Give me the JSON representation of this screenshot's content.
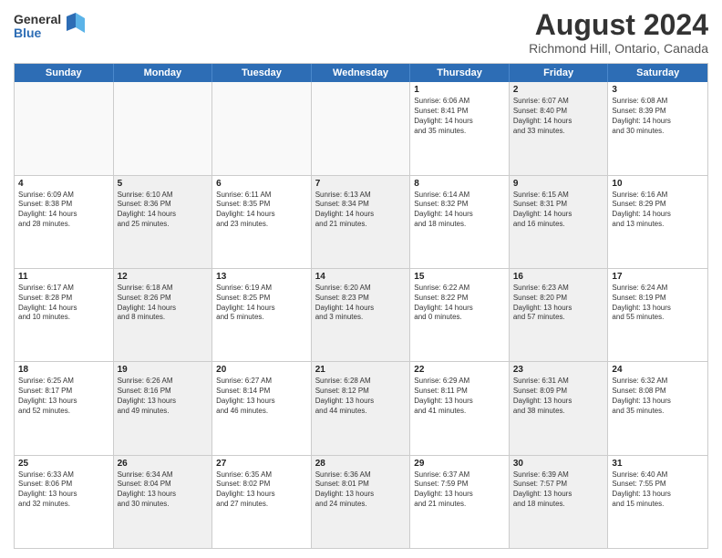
{
  "header": {
    "logo_line1": "General",
    "logo_line2": "Blue",
    "month_title": "August 2024",
    "location": "Richmond Hill, Ontario, Canada"
  },
  "days_of_week": [
    "Sunday",
    "Monday",
    "Tuesday",
    "Wednesday",
    "Thursday",
    "Friday",
    "Saturday"
  ],
  "weeks": [
    [
      {
        "day": "",
        "empty": true,
        "shaded": false
      },
      {
        "day": "",
        "empty": true,
        "shaded": false
      },
      {
        "day": "",
        "empty": true,
        "shaded": false
      },
      {
        "day": "",
        "empty": true,
        "shaded": false
      },
      {
        "day": "1",
        "empty": false,
        "shaded": false,
        "line1": "Sunrise: 6:06 AM",
        "line2": "Sunset: 8:41 PM",
        "line3": "Daylight: 14 hours",
        "line4": "and 35 minutes."
      },
      {
        "day": "2",
        "empty": false,
        "shaded": true,
        "line1": "Sunrise: 6:07 AM",
        "line2": "Sunset: 8:40 PM",
        "line3": "Daylight: 14 hours",
        "line4": "and 33 minutes."
      },
      {
        "day": "3",
        "empty": false,
        "shaded": false,
        "line1": "Sunrise: 6:08 AM",
        "line2": "Sunset: 8:39 PM",
        "line3": "Daylight: 14 hours",
        "line4": "and 30 minutes."
      }
    ],
    [
      {
        "day": "4",
        "empty": false,
        "shaded": false,
        "line1": "Sunrise: 6:09 AM",
        "line2": "Sunset: 8:38 PM",
        "line3": "Daylight: 14 hours",
        "line4": "and 28 minutes."
      },
      {
        "day": "5",
        "empty": false,
        "shaded": true,
        "line1": "Sunrise: 6:10 AM",
        "line2": "Sunset: 8:36 PM",
        "line3": "Daylight: 14 hours",
        "line4": "and 25 minutes."
      },
      {
        "day": "6",
        "empty": false,
        "shaded": false,
        "line1": "Sunrise: 6:11 AM",
        "line2": "Sunset: 8:35 PM",
        "line3": "Daylight: 14 hours",
        "line4": "and 23 minutes."
      },
      {
        "day": "7",
        "empty": false,
        "shaded": true,
        "line1": "Sunrise: 6:13 AM",
        "line2": "Sunset: 8:34 PM",
        "line3": "Daylight: 14 hours",
        "line4": "and 21 minutes."
      },
      {
        "day": "8",
        "empty": false,
        "shaded": false,
        "line1": "Sunrise: 6:14 AM",
        "line2": "Sunset: 8:32 PM",
        "line3": "Daylight: 14 hours",
        "line4": "and 18 minutes."
      },
      {
        "day": "9",
        "empty": false,
        "shaded": true,
        "line1": "Sunrise: 6:15 AM",
        "line2": "Sunset: 8:31 PM",
        "line3": "Daylight: 14 hours",
        "line4": "and 16 minutes."
      },
      {
        "day": "10",
        "empty": false,
        "shaded": false,
        "line1": "Sunrise: 6:16 AM",
        "line2": "Sunset: 8:29 PM",
        "line3": "Daylight: 14 hours",
        "line4": "and 13 minutes."
      }
    ],
    [
      {
        "day": "11",
        "empty": false,
        "shaded": false,
        "line1": "Sunrise: 6:17 AM",
        "line2": "Sunset: 8:28 PM",
        "line3": "Daylight: 14 hours",
        "line4": "and 10 minutes."
      },
      {
        "day": "12",
        "empty": false,
        "shaded": true,
        "line1": "Sunrise: 6:18 AM",
        "line2": "Sunset: 8:26 PM",
        "line3": "Daylight: 14 hours",
        "line4": "and 8 minutes."
      },
      {
        "day": "13",
        "empty": false,
        "shaded": false,
        "line1": "Sunrise: 6:19 AM",
        "line2": "Sunset: 8:25 PM",
        "line3": "Daylight: 14 hours",
        "line4": "and 5 minutes."
      },
      {
        "day": "14",
        "empty": false,
        "shaded": true,
        "line1": "Sunrise: 6:20 AM",
        "line2": "Sunset: 8:23 PM",
        "line3": "Daylight: 14 hours",
        "line4": "and 3 minutes."
      },
      {
        "day": "15",
        "empty": false,
        "shaded": false,
        "line1": "Sunrise: 6:22 AM",
        "line2": "Sunset: 8:22 PM",
        "line3": "Daylight: 14 hours",
        "line4": "and 0 minutes."
      },
      {
        "day": "16",
        "empty": false,
        "shaded": true,
        "line1": "Sunrise: 6:23 AM",
        "line2": "Sunset: 8:20 PM",
        "line3": "Daylight: 13 hours",
        "line4": "and 57 minutes."
      },
      {
        "day": "17",
        "empty": false,
        "shaded": false,
        "line1": "Sunrise: 6:24 AM",
        "line2": "Sunset: 8:19 PM",
        "line3": "Daylight: 13 hours",
        "line4": "and 55 minutes."
      }
    ],
    [
      {
        "day": "18",
        "empty": false,
        "shaded": false,
        "line1": "Sunrise: 6:25 AM",
        "line2": "Sunset: 8:17 PM",
        "line3": "Daylight: 13 hours",
        "line4": "and 52 minutes."
      },
      {
        "day": "19",
        "empty": false,
        "shaded": true,
        "line1": "Sunrise: 6:26 AM",
        "line2": "Sunset: 8:16 PM",
        "line3": "Daylight: 13 hours",
        "line4": "and 49 minutes."
      },
      {
        "day": "20",
        "empty": false,
        "shaded": false,
        "line1": "Sunrise: 6:27 AM",
        "line2": "Sunset: 8:14 PM",
        "line3": "Daylight: 13 hours",
        "line4": "and 46 minutes."
      },
      {
        "day": "21",
        "empty": false,
        "shaded": true,
        "line1": "Sunrise: 6:28 AM",
        "line2": "Sunset: 8:12 PM",
        "line3": "Daylight: 13 hours",
        "line4": "and 44 minutes."
      },
      {
        "day": "22",
        "empty": false,
        "shaded": false,
        "line1": "Sunrise: 6:29 AM",
        "line2": "Sunset: 8:11 PM",
        "line3": "Daylight: 13 hours",
        "line4": "and 41 minutes."
      },
      {
        "day": "23",
        "empty": false,
        "shaded": true,
        "line1": "Sunrise: 6:31 AM",
        "line2": "Sunset: 8:09 PM",
        "line3": "Daylight: 13 hours",
        "line4": "and 38 minutes."
      },
      {
        "day": "24",
        "empty": false,
        "shaded": false,
        "line1": "Sunrise: 6:32 AM",
        "line2": "Sunset: 8:08 PM",
        "line3": "Daylight: 13 hours",
        "line4": "and 35 minutes."
      }
    ],
    [
      {
        "day": "25",
        "empty": false,
        "shaded": false,
        "line1": "Sunrise: 6:33 AM",
        "line2": "Sunset: 8:06 PM",
        "line3": "Daylight: 13 hours",
        "line4": "and 32 minutes."
      },
      {
        "day": "26",
        "empty": false,
        "shaded": true,
        "line1": "Sunrise: 6:34 AM",
        "line2": "Sunset: 8:04 PM",
        "line3": "Daylight: 13 hours",
        "line4": "and 30 minutes."
      },
      {
        "day": "27",
        "empty": false,
        "shaded": false,
        "line1": "Sunrise: 6:35 AM",
        "line2": "Sunset: 8:02 PM",
        "line3": "Daylight: 13 hours",
        "line4": "and 27 minutes."
      },
      {
        "day": "28",
        "empty": false,
        "shaded": true,
        "line1": "Sunrise: 6:36 AM",
        "line2": "Sunset: 8:01 PM",
        "line3": "Daylight: 13 hours",
        "line4": "and 24 minutes."
      },
      {
        "day": "29",
        "empty": false,
        "shaded": false,
        "line1": "Sunrise: 6:37 AM",
        "line2": "Sunset: 7:59 PM",
        "line3": "Daylight: 13 hours",
        "line4": "and 21 minutes."
      },
      {
        "day": "30",
        "empty": false,
        "shaded": true,
        "line1": "Sunrise: 6:39 AM",
        "line2": "Sunset: 7:57 PM",
        "line3": "Daylight: 13 hours",
        "line4": "and 18 minutes."
      },
      {
        "day": "31",
        "empty": false,
        "shaded": false,
        "line1": "Sunrise: 6:40 AM",
        "line2": "Sunset: 7:55 PM",
        "line3": "Daylight: 13 hours",
        "line4": "and 15 minutes."
      }
    ]
  ]
}
